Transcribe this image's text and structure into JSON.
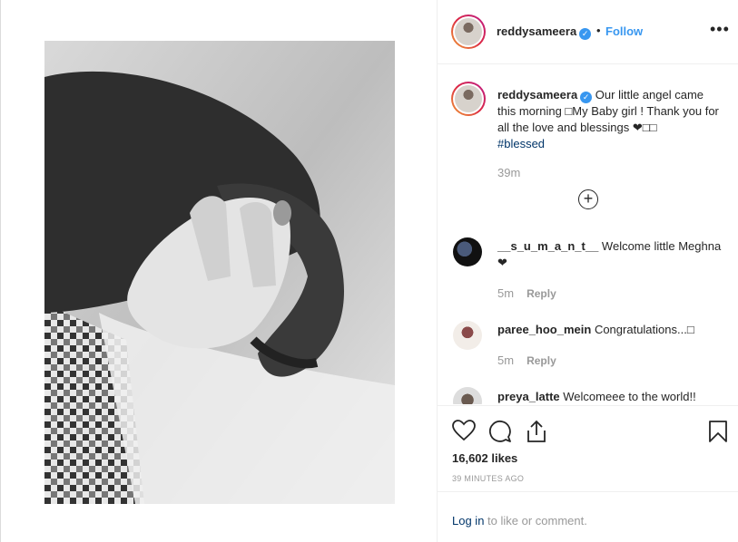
{
  "header": {
    "username": "reddysameera",
    "separator": "•",
    "follow_label": "Follow",
    "more_label": "•••"
  },
  "caption": {
    "username": "reddysameera",
    "text": " Our little angel came this morning □My Baby girl ! Thank you for all the love and blessings ❤□□",
    "hashtag": "#blessed",
    "time": "39m"
  },
  "load_more_label": "+",
  "comments": [
    {
      "username": "__s_u_m_a_n_t__",
      "text": " Welcome little Meghna❤",
      "time": "5m",
      "reply": "Reply"
    },
    {
      "username": "paree_hoo_mein",
      "text": " Congratulations...□",
      "time": "5m",
      "reply": "Reply"
    },
    {
      "username": "preya_latte",
      "text": " Welcomeee to the world!!",
      "time": "",
      "reply": ""
    }
  ],
  "actions": {
    "icons": [
      "heart-icon",
      "comment-icon",
      "share-icon",
      "bookmark-icon"
    ],
    "likes": "16,602 likes",
    "time_ago": "39 MINUTES AGO"
  },
  "login": {
    "link_label": "Log in",
    "suffix": " to like or comment."
  },
  "colors": {
    "accent": "#3897f0",
    "link": "#003569",
    "muted": "#999999",
    "text": "#262626"
  }
}
